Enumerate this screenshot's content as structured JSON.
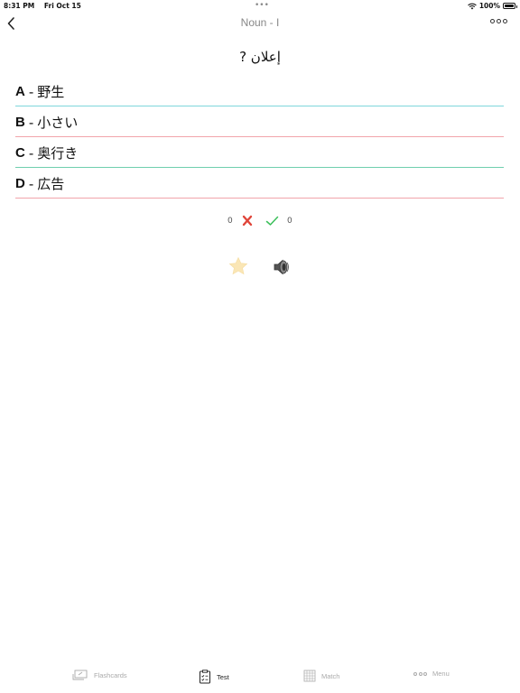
{
  "status_bar": {
    "time": "8:31 PM",
    "date": "Fri Oct 15",
    "battery": "100%",
    "battery_level": 1.0
  },
  "nav": {
    "title": "Noun - I",
    "back_icon": "chevron-left-icon",
    "more_icon": "more-dots-icon"
  },
  "question": {
    "text": "إعلان ?"
  },
  "options": [
    {
      "letter": "A",
      "sep": "-",
      "text": "野生",
      "line_color": "#7fd6dc"
    },
    {
      "letter": "B",
      "sep": "-",
      "text": "小さい",
      "line_color": "#f1a4ab"
    },
    {
      "letter": "C",
      "sep": "-",
      "text": "奥行き",
      "line_color": "#6fcfae"
    },
    {
      "letter": "D",
      "sep": "-",
      "text": "広告",
      "line_color": "#f1a4ab"
    }
  ],
  "score": {
    "wrong": "0",
    "right": "0",
    "wrong_color": "#e0453a",
    "right_color": "#3bbf5a"
  },
  "actions": {
    "star_icon": "star-icon",
    "speaker_icon": "speaker-icon"
  },
  "tabs": [
    {
      "label": "Flashcards",
      "icon": "flashcards-icon",
      "active": false
    },
    {
      "label": "Test",
      "icon": "clipboard-icon",
      "active": true
    },
    {
      "label": "Match",
      "icon": "grid-icon",
      "active": false
    },
    {
      "label": "Menu",
      "icon": "more-dots-icon",
      "active": false
    }
  ]
}
